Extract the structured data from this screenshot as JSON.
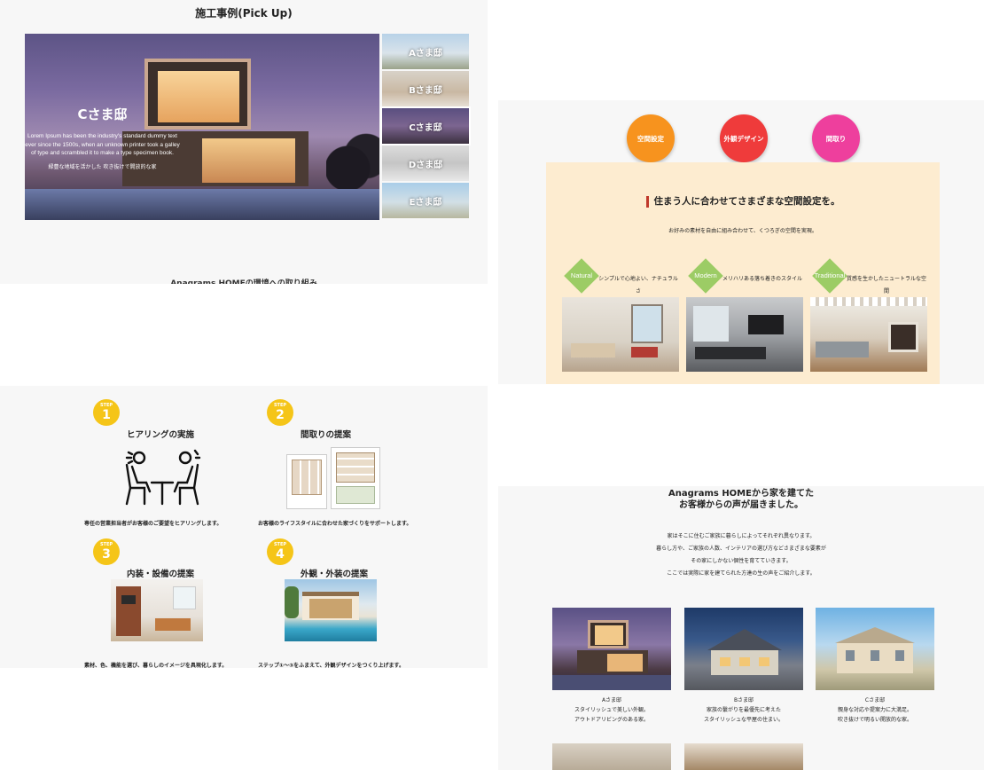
{
  "pickup": {
    "title": "施工事例(Pick Up)",
    "featured": {
      "name": "Cさま邸",
      "description": "Lorem Ipsum has been the industry's standard dummy text ever since the 1500s, when an unknown printer took a galley of type and scrambled it to make a type specimen book.",
      "note": "緑豊な地域を活かした 吹き抜けで開放的な家"
    },
    "thumbnails": [
      {
        "label": "Aさま邸"
      },
      {
        "label": "Bさま邸"
      },
      {
        "label": "Cさま邸"
      },
      {
        "label": "Dさま邸"
      },
      {
        "label": "Eさま邸"
      }
    ],
    "next_section_peek": "Anagrams HOMEの環境への取り組み"
  },
  "space": {
    "tabs": [
      {
        "label": "空間設定",
        "color": "#f7931e"
      },
      {
        "label": "外観デザイン",
        "color": "#ef3b3b"
      },
      {
        "label": "間取り",
        "color": "#ee3f9d"
      }
    ],
    "heading": "住まう人に合わせてさまざまな空間設定を。",
    "subtext": "お好みの素材を自由に組み合わせて、くつろぎの空間を実現。",
    "styles": [
      {
        "tag": "Natural",
        "desc": "シンプルで心地よい、ナチュラルさ"
      },
      {
        "tag": "Modern",
        "desc": "メリハリある落ち着きのスタイル"
      },
      {
        "tag": "Traditional",
        "desc": "質感を生かしたニュートラルな空間"
      }
    ]
  },
  "steps": {
    "items": [
      {
        "step_label": "STEP",
        "number": "1",
        "title": "ヒアリングの実施",
        "desc": "専任の営業担当者がお客様のご要望をヒアリングします。"
      },
      {
        "step_label": "STEP",
        "number": "2",
        "title": "間取りの提案",
        "desc": "お客様のライフスタイルに合わせた家づくりをサポートします。"
      },
      {
        "step_label": "STEP",
        "number": "3",
        "title": "内装・設備の提案",
        "desc": "素材、色、機能を選び、暮らしのイメージを具現化します。"
      },
      {
        "step_label": "STEP",
        "number": "4",
        "title": "外観・外装の提案",
        "desc": "ステップ①〜③をふまえて、外観デザインをつくり上げます。"
      }
    ]
  },
  "voices": {
    "title_line1": "Anagrams HOMEから家を建てた",
    "title_line2": "お客様からの声が届きました。",
    "body": [
      "家はそこに住むご家族に暮らしによってそれぞれ異なります。",
      "暮らし方や、ご家族の人数、インテリアの選び方などさまざまな要素が",
      "その家にしかない個性を育てていきます。",
      "ここでは実際に家を建てられた方達の生の声をご紹介します。"
    ],
    "cards": [
      {
        "name": "Aさま邸",
        "line1": "スタイリッシュで美しい外観。",
        "line2": "アウトドアリビングのある家。"
      },
      {
        "name": "Bさま邸",
        "line1": "家族の繋がりを最優先に考えた",
        "line2": "スタイリッシュな平屋の住まい。"
      },
      {
        "name": "Cさま邸",
        "line1": "親身な対応や提案力に大満足。",
        "line2": "吹き抜けで明るい開放的な家。"
      }
    ]
  }
}
